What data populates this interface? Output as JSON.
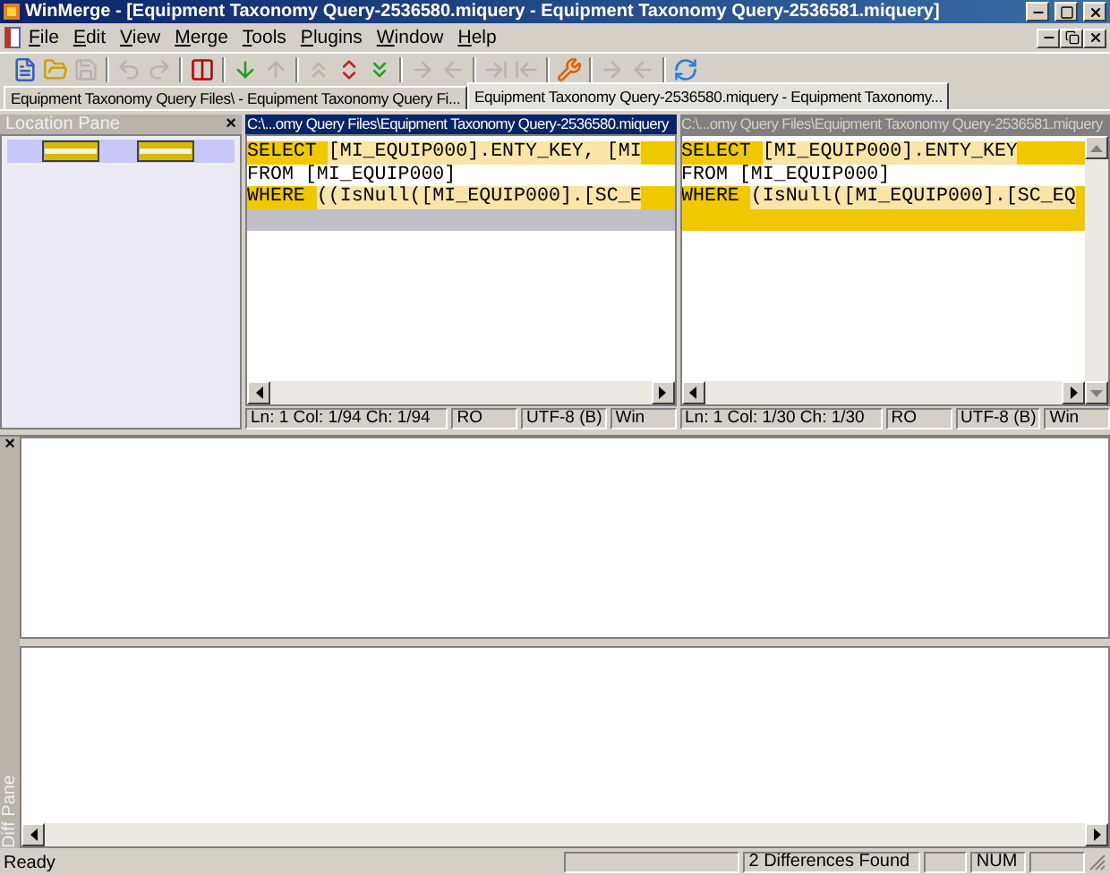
{
  "window": {
    "title": "WinMerge - [Equipment Taxonomy Query-2536580.miquery - Equipment Taxonomy Query-2536581.miquery]"
  },
  "menu": [
    "File",
    "Edit",
    "View",
    "Merge",
    "Tools",
    "Plugins",
    "Window",
    "Help"
  ],
  "toolbar": [
    {
      "kind": "button",
      "disabled": false
    },
    {
      "kind": "button",
      "disabled": false
    },
    {
      "kind": "button",
      "disabled": true
    },
    {
      "kind": "separator"
    },
    {
      "kind": "button",
      "disabled": true
    },
    {
      "kind": "button",
      "disabled": true
    },
    {
      "kind": "separator"
    },
    {
      "kind": "button",
      "disabled": false
    },
    {
      "kind": "separator"
    },
    {
      "kind": "button",
      "disabled": false
    },
    {
      "kind": "button",
      "disabled": true
    },
    {
      "kind": "separator"
    },
    {
      "kind": "button",
      "disabled": true
    },
    {
      "kind": "button",
      "disabled": false
    },
    {
      "kind": "button",
      "disabled": false
    },
    {
      "kind": "separator"
    },
    {
      "kind": "button",
      "disabled": true
    },
    {
      "kind": "button",
      "disabled": true
    },
    {
      "kind": "separator"
    },
    {
      "kind": "button",
      "disabled": true
    },
    {
      "kind": "button",
      "disabled": true
    },
    {
      "kind": "separator"
    },
    {
      "kind": "button",
      "disabled": false
    },
    {
      "kind": "separator"
    },
    {
      "kind": "button",
      "disabled": true
    },
    {
      "kind": "button",
      "disabled": true
    },
    {
      "kind": "separator"
    },
    {
      "kind": "button",
      "disabled": false
    }
  ],
  "tabs": [
    {
      "label": "Equipment Taxonomy Query Files\\ - Equipment Taxonomy Query Fi...",
      "selected": false
    },
    {
      "label": "Equipment Taxonomy Query-2536580.miquery - Equipment Taxonomy...",
      "selected": true
    }
  ],
  "location_pane": {
    "title": "Location Pane",
    "close": "×"
  },
  "editors": [
    {
      "path": "C:\\...omy Query Files\\Equipment Taxonomy Query-2536580.miquery",
      "active": true,
      "lines": [
        {
          "kind": "diff",
          "segments": [
            {
              "text": "SELECT ",
              "changed": false
            },
            {
              "text": "[MI_EQUIP000].ENTY_KEY, [MI",
              "changed": true
            }
          ]
        },
        {
          "kind": "same",
          "segments": [
            {
              "text": "FROM [MI_EQUIP000]",
              "changed": false
            }
          ]
        },
        {
          "kind": "diff",
          "segments": [
            {
              "text": "WHERE ",
              "changed": false
            },
            {
              "text": "((IsNull([MI_EQUIP000].[SC_E",
              "changed": true
            }
          ]
        },
        {
          "kind": "missing"
        }
      ],
      "status": [
        "Ln: 1  Col: 1/94  Ch: 1/94",
        "RO",
        "UTF-8 (B)",
        "Win"
      ]
    },
    {
      "path": "C:\\...omy Query Files\\Equipment Taxonomy Query-2536581.miquery",
      "active": false,
      "lines": [
        {
          "kind": "diff",
          "segments": [
            {
              "text": "SELECT ",
              "changed": false
            },
            {
              "text": "[MI_EQUIP000].ENTY_KEY",
              "changed": true
            }
          ]
        },
        {
          "kind": "same",
          "segments": [
            {
              "text": "FROM [MI_EQUIP000]",
              "changed": false
            }
          ]
        },
        {
          "kind": "diff",
          "segments": [
            {
              "text": "WHERE ",
              "changed": false
            },
            {
              "text": "(IsNull([MI_EQUIP000].[SC_EQ",
              "changed": true
            }
          ]
        },
        {
          "kind": "diff"
        }
      ],
      "status": [
        "Ln: 1  Col: 1/30  Ch: 1/30",
        "RO",
        "UTF-8 (B)",
        "Win"
      ]
    }
  ],
  "diff_pane": {
    "title": "Diff Pane",
    "close": "×"
  },
  "status_bar": {
    "message": "Ready",
    "differences": "2 Differences Found",
    "keyboard": "NUM"
  }
}
